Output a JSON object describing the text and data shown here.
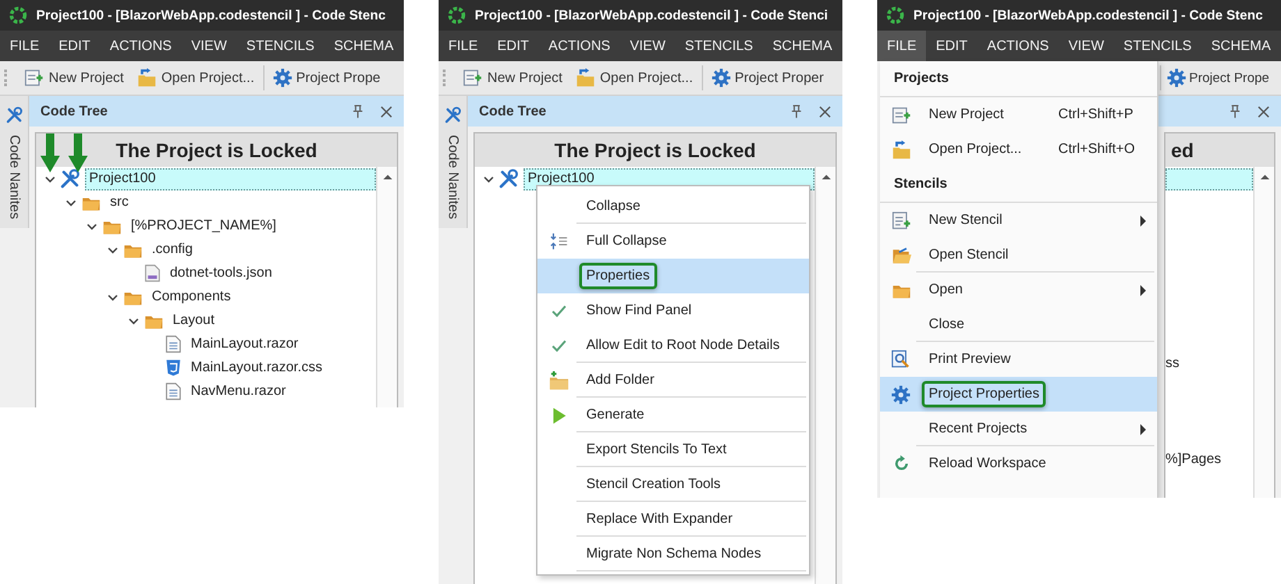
{
  "panels": [
    {
      "title": "Project100 -  [BlazorWebApp.codestencil ] - Code Stenc",
      "menu": [
        {
          "label": "FILE",
          "selected": false
        },
        {
          "label": "EDIT",
          "selected": false
        },
        {
          "label": "ACTIONS",
          "selected": false
        },
        {
          "label": "VIEW",
          "selected": false
        },
        {
          "label": "STENCILS",
          "selected": false
        },
        {
          "label": "SCHEMA",
          "selected": false
        }
      ],
      "toolbar": [
        {
          "label": "New Project",
          "kind": "new-project"
        },
        {
          "label": "Open Project...",
          "kind": "open-project"
        },
        {
          "label": "Project Prope",
          "kind": "properties"
        }
      ],
      "side_tab": "Code Nanites",
      "tree_panel": {
        "title": "Code Tree",
        "heading": "The Project is Locked",
        "items": [
          {
            "label": "Project100",
            "kind": "root",
            "selected": true,
            "expanded": true,
            "children": [
              {
                "label": "src",
                "kind": "folder",
                "selected": false,
                "expanded": true,
                "children": [
                  {
                    "label": "[%PROJECT_NAME%]",
                    "kind": "folder",
                    "selected": false,
                    "expanded": true,
                    "children": [
                      {
                        "label": ".config",
                        "kind": "folder",
                        "selected": false,
                        "expanded": true,
                        "children": [
                          {
                            "label": "dotnet-tools.json",
                            "kind": "json",
                            "selected": false
                          }
                        ]
                      },
                      {
                        "label": "Components",
                        "kind": "folder",
                        "selected": false,
                        "expanded": true,
                        "children": [
                          {
                            "label": "Layout",
                            "kind": "folder",
                            "selected": false,
                            "expanded": true,
                            "children": [
                              {
                                "label": "MainLayout.razor",
                                "kind": "razor",
                                "selected": false
                              },
                              {
                                "label": "MainLayout.razor.css",
                                "kind": "css",
                                "selected": false
                              },
                              {
                                "label": "NavMenu.razor",
                                "kind": "razor",
                                "selected": false
                              }
                            ]
                          }
                        ]
                      }
                    ]
                  }
                ]
              }
            ]
          }
        ]
      },
      "callout_arrows": true
    },
    {
      "title": "Project100 -  [BlazorWebApp.codestencil ] - Code Stenci",
      "menu": [
        {
          "label": "FILE",
          "selected": false
        },
        {
          "label": "EDIT",
          "selected": false
        },
        {
          "label": "ACTIONS",
          "selected": false
        },
        {
          "label": "VIEW",
          "selected": false
        },
        {
          "label": "STENCILS",
          "selected": false
        },
        {
          "label": "SCHEMA",
          "selected": false
        }
      ],
      "toolbar": [
        {
          "label": "New Project",
          "kind": "new-project"
        },
        {
          "label": "Open Project...",
          "kind": "open-project"
        },
        {
          "label": "Project Proper",
          "kind": "properties"
        }
      ],
      "side_tab": "Code Nanites",
      "tree_panel": {
        "title": "Code Tree",
        "heading": "The Project is Locked",
        "items": [
          {
            "label": "Project100",
            "kind": "root",
            "selected": true,
            "expanded": true
          }
        ]
      },
      "context_menu": [
        {
          "label": "Collapse",
          "kind": "plain",
          "selected": false,
          "separator_after": true
        },
        {
          "label": "Full Collapse",
          "kind": "collapse-all",
          "selected": false,
          "separator_after": false
        },
        {
          "label": "Properties",
          "kind": "plain",
          "selected": true,
          "separator_after": false
        },
        {
          "label": "Show Find Panel",
          "kind": "check",
          "checked": true,
          "selected": false,
          "separator_after": false
        },
        {
          "label": "Allow Edit to Root Node Details",
          "kind": "check",
          "checked": true,
          "selected": false,
          "separator_after": true
        },
        {
          "label": "Add Folder",
          "kind": "add-folder",
          "selected": false,
          "separator_after": true
        },
        {
          "label": "Generate",
          "kind": "generate",
          "selected": false,
          "separator_after": true
        },
        {
          "label": "Export Stencils To Text",
          "kind": "plain",
          "selected": false,
          "separator_after": true
        },
        {
          "label": "Stencil Creation Tools",
          "kind": "plain",
          "selected": false,
          "separator_after": true
        },
        {
          "label": "Replace With Expander",
          "kind": "plain",
          "selected": false,
          "separator_after": true
        },
        {
          "label": "Migrate Non Schema Nodes",
          "kind": "plain",
          "selected": false,
          "separator_after": true
        }
      ]
    },
    {
      "title": "Project100 -  [BlazorWebApp.codestencil ] - Code Stenc",
      "menu": [
        {
          "label": "FILE",
          "selected": true
        },
        {
          "label": "EDIT",
          "selected": false
        },
        {
          "label": "ACTIONS",
          "selected": false
        },
        {
          "label": "VIEW",
          "selected": false
        },
        {
          "label": "STENCILS",
          "selected": false
        },
        {
          "label": "SCHEMA",
          "selected": false
        }
      ],
      "toolbar": [
        {
          "label": "Project Prope",
          "kind": "properties"
        }
      ],
      "tree_panel": {
        "heading": "ed",
        "root_selected": true,
        "fragments": [
          "ss",
          "%]Pages"
        ]
      },
      "file_menu": [
        {
          "kind": "header",
          "label": "Projects"
        },
        {
          "kind": "new-project",
          "label": "New Project",
          "shortcut": "Ctrl+Shift+P",
          "selected": false
        },
        {
          "kind": "open-project",
          "label": "Open Project...",
          "shortcut": "Ctrl+Shift+O",
          "selected": false
        },
        {
          "kind": "header",
          "label": "Stencils"
        },
        {
          "kind": "new-stencil",
          "label": "New Stencil",
          "submenu": true,
          "selected": false
        },
        {
          "kind": "open-stencil",
          "label": "Open Stencil",
          "selected": false,
          "separator_after": true
        },
        {
          "kind": "open-folder",
          "label": "Open",
          "submenu": true,
          "selected": false
        },
        {
          "kind": "none",
          "label": "Close",
          "selected": false,
          "separator_after": true
        },
        {
          "kind": "print-preview",
          "label": "Print Preview",
          "selected": false
        },
        {
          "kind": "properties",
          "label": "Project Properties",
          "selected": true
        },
        {
          "kind": "none",
          "label": "Recent Projects",
          "submenu": true,
          "selected": false,
          "separator_after": true
        },
        {
          "kind": "reload",
          "label": "Reload Workspace",
          "selected": false
        }
      ]
    }
  ]
}
